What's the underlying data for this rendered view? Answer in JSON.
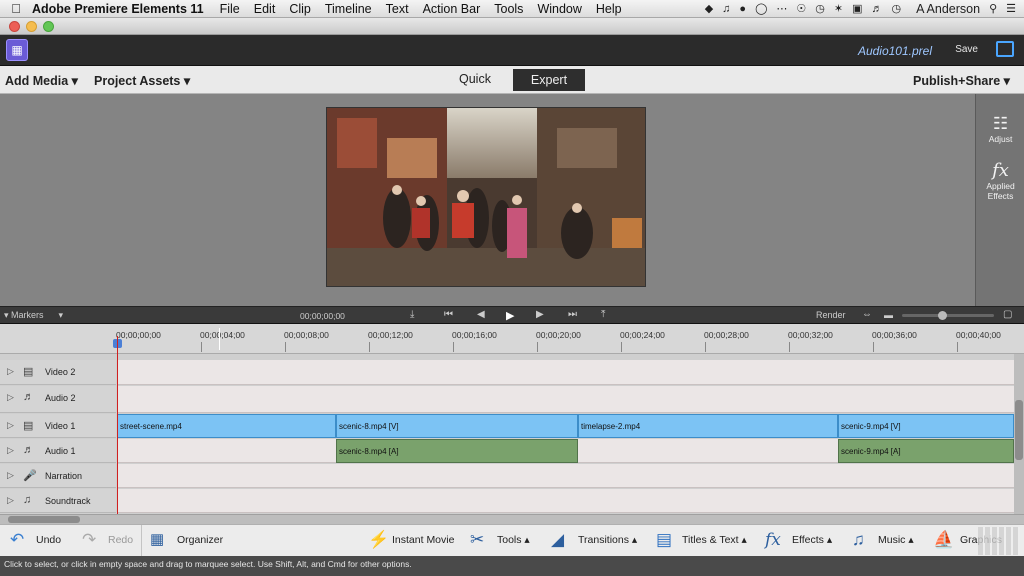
{
  "menubar": {
    "app_name": "Adobe Premiere Elements 11",
    "items": [
      "File",
      "Edit",
      "Clip",
      "Timeline",
      "Text",
      "Action Bar",
      "Tools",
      "Window",
      "Help"
    ],
    "user": "A Anderson"
  },
  "header": {
    "project_name": "Audio101.prel",
    "save_label": "Save"
  },
  "toolbar": {
    "add_media": "Add Media",
    "project_assets": "Project Assets",
    "quick": "Quick",
    "expert": "Expert",
    "publish_share": "Publish+Share"
  },
  "right_panel": {
    "adjust": "Adjust",
    "applied_effects_1": "Applied",
    "applied_effects_2": "Effects"
  },
  "timeline_controls": {
    "markers": "Markers",
    "timecode": "00;00;00;00",
    "render": "Render"
  },
  "ruler": {
    "ticks": [
      "00;00;00;00",
      "00;00;04;00",
      "00;00;08;00",
      "00;00;12;00",
      "00;00;16;00",
      "00;00;20;00",
      "00;00;24;00",
      "00;00;28;00",
      "00;00;32;00",
      "00;00;36;00",
      "00;00;40;00"
    ]
  },
  "tracks": {
    "video2": "Video 2",
    "audio2": "Audio 2",
    "video1": "Video 1",
    "audio1": "Audio 1",
    "narration": "Narration",
    "soundtrack": "Soundtrack"
  },
  "clips": {
    "v1": "street-scene.mp4",
    "v2": "scenic-8.mp4 [V]",
    "v3": "timelapse-2.mp4",
    "v4": "scenic-9.mp4 [V]",
    "a2": "scenic-8.mp4 [A]",
    "a4": "scenic-9.mp4 [A]"
  },
  "actionbar": {
    "undo": "Undo",
    "redo": "Redo",
    "organizer": "Organizer",
    "instant_movie": "Instant Movie",
    "tools": "Tools",
    "transitions": "Transitions",
    "titles_text": "Titles & Text",
    "effects": "Effects",
    "music": "Music",
    "graphics": "Graphics"
  },
  "status_text": "Click to select, or click in empty space and drag to marquee select. Use Shift, Alt, and Cmd for other options."
}
